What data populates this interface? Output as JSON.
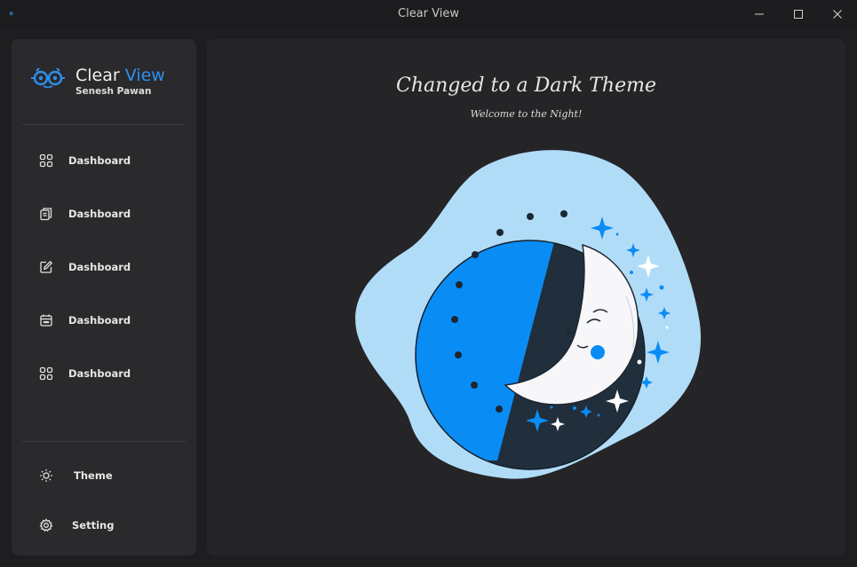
{
  "window": {
    "title": "Clear View",
    "app_icon_text": "∝",
    "controls": {
      "minimize": "minimize-icon",
      "maximize": "maximize-icon",
      "close": "close-icon"
    }
  },
  "sidebar": {
    "logo": {
      "title_primary": "Clear",
      "title_accent": "View",
      "subtitle": "Senesh Pawan"
    },
    "nav": [
      {
        "label": "Dashboard",
        "icon": "grid-icon"
      },
      {
        "label": "Dashboard",
        "icon": "documents-icon"
      },
      {
        "label": "Dashboard",
        "icon": "edit-icon"
      },
      {
        "label": "Dashboard",
        "icon": "calendar-icon"
      },
      {
        "label": "Dashboard",
        "icon": "grid-icon"
      }
    ],
    "bottom": [
      {
        "label": "Theme",
        "icon": "sun-icon"
      },
      {
        "label": "Setting",
        "icon": "gear-icon"
      }
    ]
  },
  "main": {
    "heading": "Changed to a Dark Theme",
    "subheading": "Welcome to the Night!",
    "illustration": "moon-night-illustration"
  },
  "colors": {
    "accent": "#2f8ff0",
    "blob": "#b1dcf8",
    "moon_bg_blue": "#0a8cf5",
    "night_navy": "#212e3b",
    "panel": "#252528",
    "sidebar": "#2a2a2d"
  }
}
